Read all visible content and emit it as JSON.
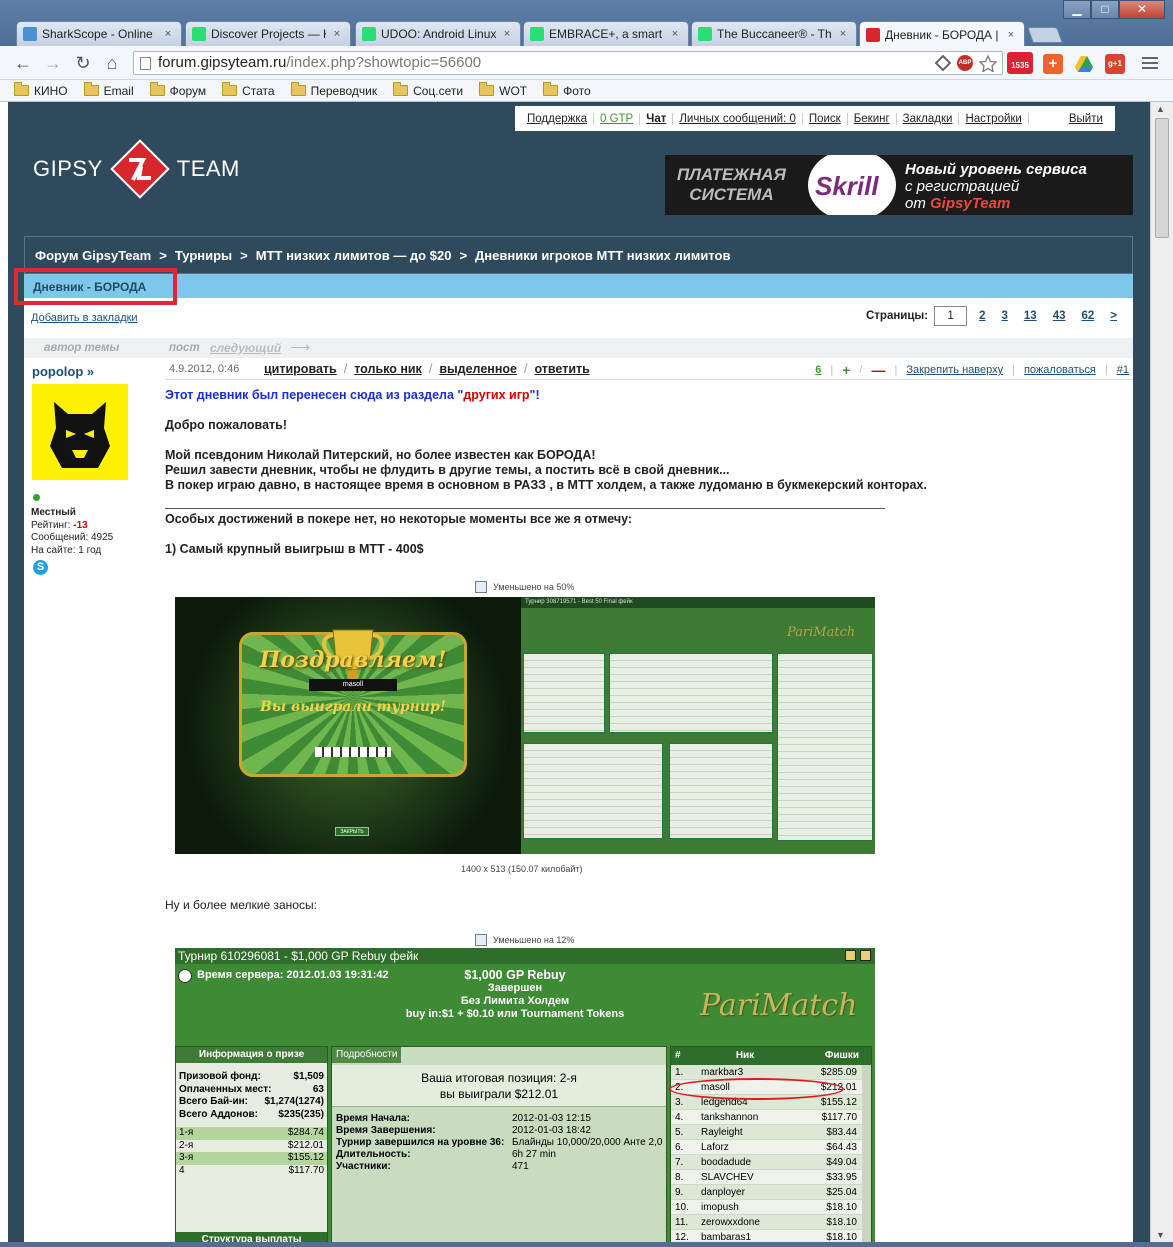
{
  "browser": {
    "tabs": [
      {
        "title": "SharkScope - Online",
        "icon": "sharkscope-favicon",
        "color": "#4a8fd0"
      },
      {
        "title": "Discover Projects — K",
        "icon": "kickstarter-favicon",
        "color": "#2bde73"
      },
      {
        "title": "UDOO: Android Linux",
        "icon": "kickstarter-favicon",
        "color": "#2bde73"
      },
      {
        "title": "EMBRACE+, a smart p",
        "icon": "kickstarter-favicon",
        "color": "#2bde73"
      },
      {
        "title": "The Buccaneer® - Th",
        "icon": "kickstarter-favicon",
        "color": "#2bde73"
      },
      {
        "title": "Дневник - БОРОДА | ",
        "icon": "gipsyteam-favicon",
        "color": "#d8262d"
      }
    ],
    "tab_close": "×",
    "window_minimize": "▁",
    "window_maximize": "□",
    "window_close": "✕",
    "url_host": "forum.gipsyteam.ru",
    "url_path": "/index.php?showtopic=56600",
    "bookmarks": [
      "КИНО",
      "Email",
      "Форум",
      "Стата",
      "Переводчик",
      "Соц.сети",
      "WOT",
      "Фото"
    ],
    "extensions": {
      "abp": "ABP",
      "gmail_count": "1535"
    }
  },
  "userbar": {
    "items": [
      "Поддержка",
      "0 GTP",
      "Чат",
      "Личных сообщений: 0",
      "Поиск",
      "Бекинг",
      "Закладки",
      "Настройки"
    ],
    "logout": "Выйти"
  },
  "logo": {
    "left": "GIPSY",
    "right": "TEAM"
  },
  "banner": {
    "left_line1": "ПЛАТЕЖНАЯ",
    "left_line2": "СИСТЕМА",
    "brand": "Skrill",
    "line1": "Новый уровень сервиса",
    "line2": "с регистрацией",
    "line3_prefix": "от ",
    "line3_brand": "GipsyTeam"
  },
  "breadcrumb": [
    "Форум GipsyTeam",
    "Турниры",
    "МТТ низких лимитов — до $20",
    "Дневники игроков МТТ низких лимитов"
  ],
  "breadcrumb_sep": ">",
  "topic": {
    "title": "Дневник - БОРОДА",
    "add_bookmark": "Добавить в закладки",
    "pages_label": "Страницы:",
    "current_page": "1",
    "pages": [
      "2",
      "3",
      "13",
      "43",
      "62"
    ],
    "next": ">"
  },
  "postbar": {
    "author_label": "автор темы",
    "post": "пост",
    "next": "следующий",
    "arrow": "⟶"
  },
  "post": {
    "author": "popolop »",
    "rank": "Местный",
    "rating_label": "Рейтинг: ",
    "rating": "-13",
    "messages": "Сообщений: 4925",
    "on_site": "На сайте: 1 год",
    "date": "4.9.2012, 0:46",
    "actions": [
      "цитировать",
      "только ник",
      "выделенное",
      "ответить"
    ],
    "rating_value": "6",
    "plus": "+",
    "minus": "—",
    "pin": "Закрепить наверху",
    "complain": "пожаловаться",
    "number": "#1",
    "moved_prefix": "Этот дневник был перенесен сюда из раздела \"",
    "moved_section": "других игр",
    "moved_suffix": "\"!",
    "welcome": "Добро пожаловать!",
    "intro1": "Мой псевдоним Николай Питерский, но более известен как БОРОДА!",
    "intro2": "Решил завести дневник, чтобы не флудить в другие темы, а постить всё в свой дневник...",
    "intro3": "В покер играю давно, в настоящее время в основном в РАЗЗ , в МТТ холдем, а также лудоманю в букмекерский конторах.",
    "achievements": "Особых достижений в покере нет, но некоторые моменты все же я отмечу:",
    "item1": "1) Самый крупный выигрыш в МТТ - 400$",
    "img1_note": "Уменьшено на 50%",
    "img1_dims": "1400 x 513 (150.07 килобайт)",
    "smaller": "Ну и более мелкие заносы:",
    "img2_note": "Уменьшено на 12%"
  },
  "shot1": {
    "congrats": "Поздравляем!",
    "winner": "masoll",
    "won": "Вы выиграли турнир!",
    "close_btn": "ЗАКРЫТЬ",
    "tourney_title": "Турнир 308719571 - Best 50 Final фейк",
    "brand": "PariMatch"
  },
  "shot2": {
    "title": "Турнир 610296081 - $1,000 GP Rebuy фейк",
    "server_time": "Время сервера: 2012.01.03 19:31:42",
    "name": "$1,000 GP Rebuy",
    "status": "Завершен",
    "game": "Без Лимита Холдем",
    "buyin": "buy in:$1 + $0.10 или Tournament Tokens",
    "brand": "PariMatch",
    "prize_header": "Информация о призе",
    "prize_rows": [
      {
        "k": "Призовой фонд:",
        "v": "$1,509"
      },
      {
        "k": "Оплаченных мест:",
        "v": "63"
      },
      {
        "k": "Всего Бай-ин:",
        "v": "$1,274(1274)"
      },
      {
        "k": "Всего Аддонов:",
        "v": "$235(235)"
      }
    ],
    "payouts": [
      {
        "k": "1-я",
        "v": "$284.74"
      },
      {
        "k": "2-я",
        "v": "$212.01"
      },
      {
        "k": "3-я",
        "v": "$155.12"
      },
      {
        "k": "4",
        "v": "$117.70"
      }
    ],
    "payout_structure": "Структура выплаты",
    "details_tab": "Подробности",
    "result_line1": "Ваша итоговая позиция: 2-я",
    "result_line2": "вы выиграли $212.01",
    "details": [
      {
        "k": "Время Начала:",
        "v": "2012-01-03 12:15"
      },
      {
        "k": "Время Завершения:",
        "v": "2012-01-03 18:42"
      },
      {
        "k": "Турнир завершился на уровне 36:",
        "v": "Блайнды 10,000/20,000 Анте 2,0"
      },
      {
        "k": "Длительность:",
        "v": "6h 27 min"
      },
      {
        "k": "Участники:",
        "v": "471"
      }
    ],
    "list_headers": [
      "#",
      "Ник",
      "Фишки"
    ],
    "players": [
      {
        "n": "1.",
        "nick": "markbar3",
        "chips": "$285.09"
      },
      {
        "n": "2.",
        "nick": "masoll",
        "chips": "$212.01"
      },
      {
        "n": "3.",
        "nick": "ledgend64",
        "chips": "$155.12"
      },
      {
        "n": "4.",
        "nick": "tankshannon",
        "chips": "$117.70"
      },
      {
        "n": "5.",
        "nick": "Rayleight",
        "chips": "$83.44"
      },
      {
        "n": "6.",
        "nick": "Laforz",
        "chips": "$64.43"
      },
      {
        "n": "7.",
        "nick": "boodadude",
        "chips": "$49.04"
      },
      {
        "n": "8.",
        "nick": "SLAVCHEV",
        "chips": "$33.95"
      },
      {
        "n": "9.",
        "nick": "danployer",
        "chips": "$25.04"
      },
      {
        "n": "10.",
        "nick": "imopush",
        "chips": "$18.10"
      },
      {
        "n": "11.",
        "nick": "zerowxxdone",
        "chips": "$18.10"
      },
      {
        "n": "12.",
        "nick": "bambaras1",
        "chips": "$18.10"
      }
    ]
  }
}
